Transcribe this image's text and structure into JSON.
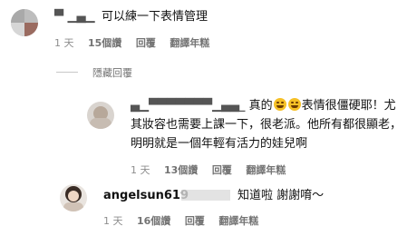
{
  "comments": [
    {
      "name": "▀ ▁▄▁",
      "text": "可以練一下表情管理",
      "meta": {
        "time": "1 天",
        "likes": "15個讚",
        "reply": "回覆",
        "translate": "翻譯年糕"
      }
    },
    {
      "name": "▄▁▀▀▀▀▀▀▀▁▄▄_",
      "text_before": "真的",
      "emoji": [
        "grinning-sweat-emoji",
        "grinning-sweat-emoji"
      ],
      "text_after": "表情很僵硬耶！尤其妝容也需要上課一下，很老派。他所有都很顯老，明明就是一個年輕有活力的娃兒啊",
      "meta": {
        "time": "1 天",
        "likes": "13個讚",
        "reply": "回覆",
        "translate": "翻譯年糕"
      }
    },
    {
      "name": "angelsun619",
      "text": "知道啦 謝謝唷～",
      "meta": {
        "time": "1 天",
        "likes": "16個讚",
        "reply": "回覆",
        "translate": "翻譯年糕"
      }
    }
  ],
  "hide_replies": "隱藏回覆"
}
